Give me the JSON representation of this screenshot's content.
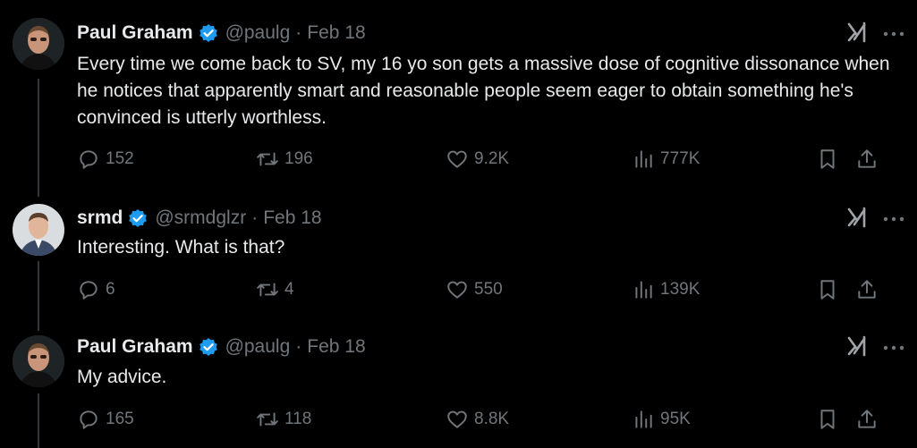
{
  "tweets": [
    {
      "name": "Paul Graham",
      "handle": "@paulg",
      "separator": "·",
      "date": "Feb 18",
      "text": "Every time we come back to SV, my 16 yo son gets a massive dose of cognitive dissonance when he notices that apparently smart and reasonable people seem eager to obtain something he's convinced is utterly worthless.",
      "replies": "152",
      "retweets": "196",
      "likes": "9.2K",
      "views": "777K"
    },
    {
      "name": "srmd",
      "handle": "@srmdglzr",
      "separator": "·",
      "date": "Feb 18",
      "text": "Interesting. What is that?",
      "replies": "6",
      "retweets": "4",
      "likes": "550",
      "views": "139K"
    },
    {
      "name": "Paul Graham",
      "handle": "@paulg",
      "separator": "·",
      "date": "Feb 18",
      "text": "My advice.",
      "replies": "165",
      "retweets": "118",
      "likes": "8.8K",
      "views": "95K"
    }
  ],
  "icons": {
    "verified": "verified-badge-icon",
    "grok": "grok-icon",
    "more": "more-dots-icon",
    "reply": "reply-icon",
    "retweet": "retweet-icon",
    "like": "heart-icon",
    "views": "views-bar-icon",
    "bookmark": "bookmark-icon",
    "share": "share-icon"
  },
  "colors": {
    "background": "#000000",
    "text": "#e7e9ea",
    "muted": "#71767b",
    "verified": "#1d9bf0",
    "thread_line": "#333639"
  }
}
